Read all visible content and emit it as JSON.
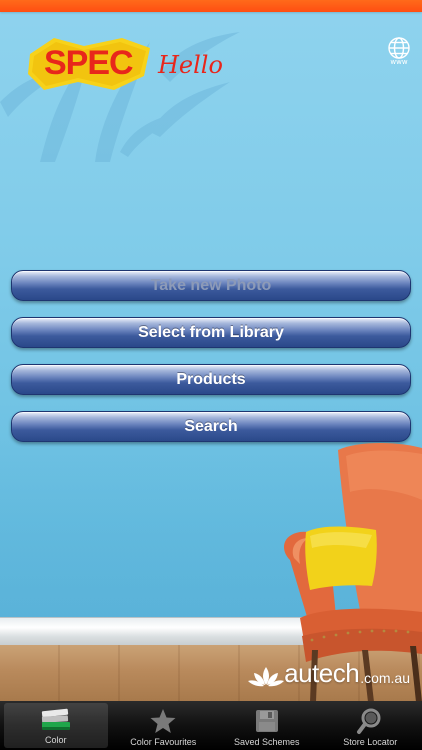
{
  "app": {
    "logo_primary": "SPEC",
    "logo_secondary": "Hello",
    "globe_label": "www"
  },
  "menu": {
    "items": [
      {
        "label": "Take new Photo",
        "enabled": false
      },
      {
        "label": "Select from Library",
        "enabled": true
      },
      {
        "label": "Products",
        "enabled": true
      },
      {
        "label": "Search",
        "enabled": true
      }
    ]
  },
  "branding": {
    "name": "autech",
    "domain_suffix": ".com.au"
  },
  "tabbar": {
    "tabs": [
      {
        "label": "Color",
        "icon": "color-swatches-icon",
        "active": true
      },
      {
        "label": "Color Favourites",
        "icon": "star-icon",
        "active": false
      },
      {
        "label": "Saved Schemes",
        "icon": "floppy-disk-icon",
        "active": false
      },
      {
        "label": "Store Locator",
        "icon": "magnifier-icon",
        "active": false
      }
    ]
  },
  "colors": {
    "accent_orange": "#ff5a16",
    "logo_red": "#e8261b",
    "logo_yellow": "#f7d21a",
    "button_blue": "#3c5a9d",
    "wall_blue": "#7fcbe9"
  }
}
